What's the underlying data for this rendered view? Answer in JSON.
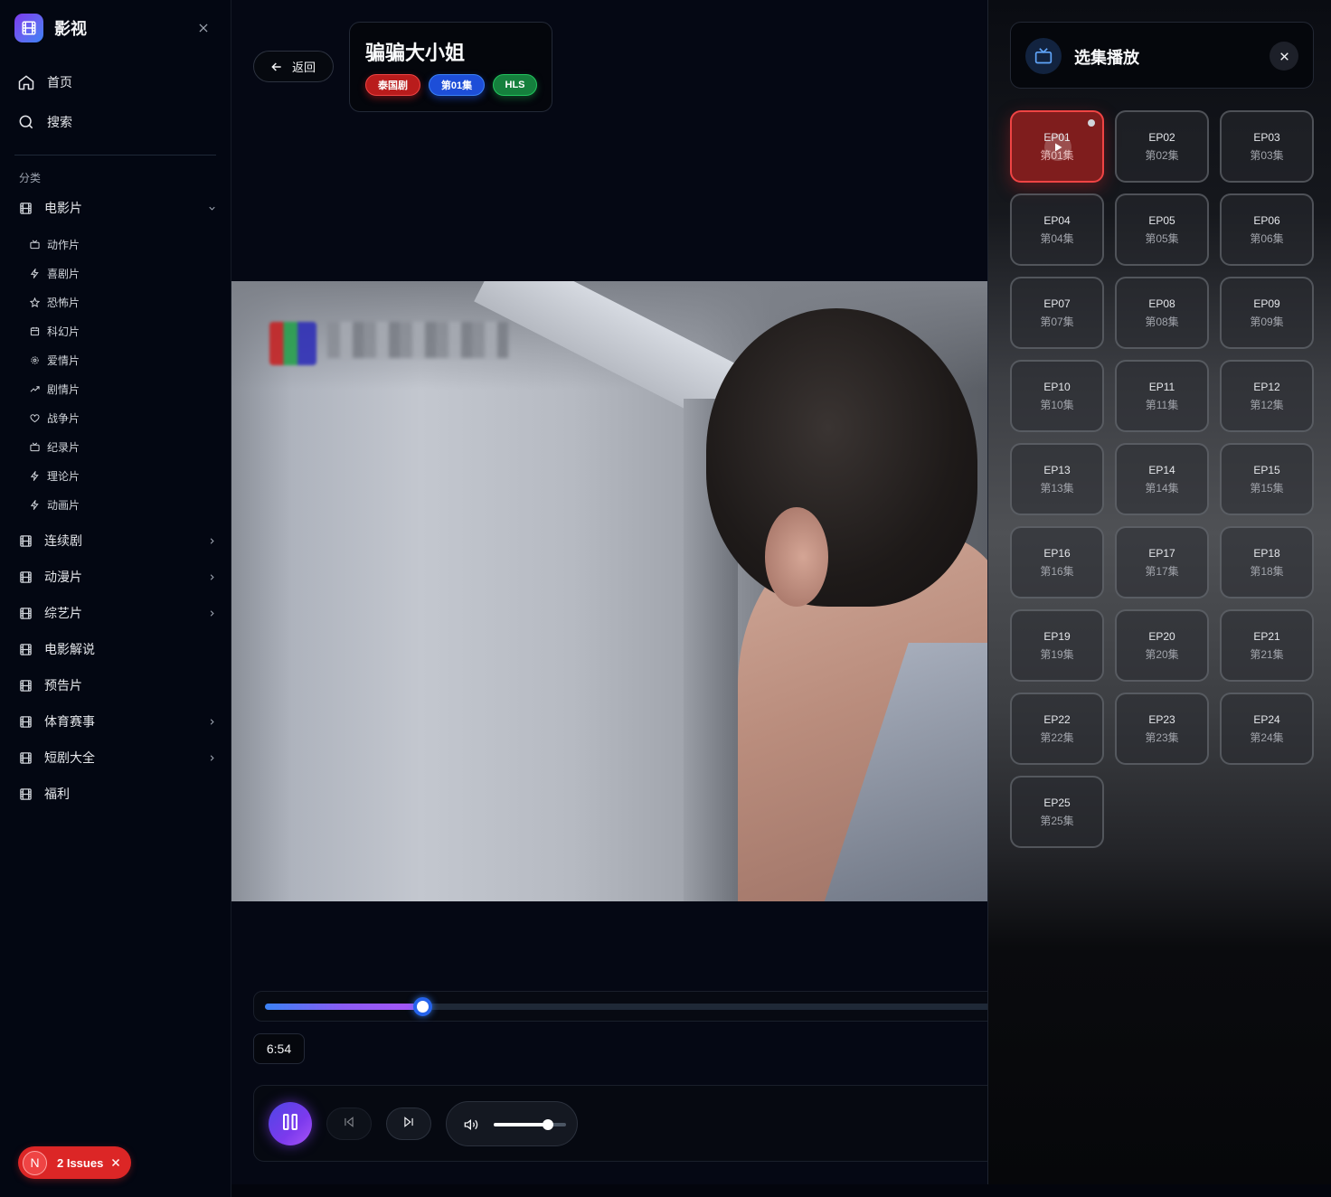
{
  "app": {
    "name": "影视"
  },
  "nav": {
    "home": "首页",
    "search": "搜索"
  },
  "sidebar": {
    "section_title": "分类",
    "movies": {
      "label": "电影片",
      "expanded": true
    },
    "sub_items": [
      {
        "label": "动作片",
        "icon": "tv-icon"
      },
      {
        "label": "喜剧片",
        "icon": "zap-icon"
      },
      {
        "label": "恐怖片",
        "icon": "star-icon"
      },
      {
        "label": "科幻片",
        "icon": "calendar-icon"
      },
      {
        "label": "爱情片",
        "icon": "settings-icon"
      },
      {
        "label": "剧情片",
        "icon": "trending-icon"
      },
      {
        "label": "战争片",
        "icon": "heart-icon"
      },
      {
        "label": "纪录片",
        "icon": "tv-icon"
      },
      {
        "label": "理论片",
        "icon": "zap-icon"
      },
      {
        "label": "动画片",
        "icon": "zap-icon"
      }
    ],
    "categories": [
      {
        "label": "连续剧",
        "has_children": true
      },
      {
        "label": "动漫片",
        "has_children": true
      },
      {
        "label": "综艺片",
        "has_children": true
      },
      {
        "label": "电影解说",
        "has_children": false
      },
      {
        "label": "预告片",
        "has_children": false
      },
      {
        "label": "体育赛事",
        "has_children": true
      },
      {
        "label": "短剧大全",
        "has_children": true
      },
      {
        "label": "福利",
        "has_children": false
      }
    ]
  },
  "issues": {
    "badge": "N",
    "label": "2 Issues"
  },
  "player": {
    "back_label": "返回",
    "title": "骗骗大小姐",
    "tags": {
      "genre": "泰国剧",
      "episode": "第01集",
      "format": "HLS"
    },
    "current_time": "6:54",
    "progress_fraction": 0.21,
    "volume_fraction": 0.75
  },
  "episode_panel": {
    "title": "选集播放",
    "active_index": 0,
    "episodes": [
      {
        "code": "EP01",
        "name": "第01集"
      },
      {
        "code": "EP02",
        "name": "第02集"
      },
      {
        "code": "EP03",
        "name": "第03集"
      },
      {
        "code": "EP04",
        "name": "第04集"
      },
      {
        "code": "EP05",
        "name": "第05集"
      },
      {
        "code": "EP06",
        "name": "第06集"
      },
      {
        "code": "EP07",
        "name": "第07集"
      },
      {
        "code": "EP08",
        "name": "第08集"
      },
      {
        "code": "EP09",
        "name": "第09集"
      },
      {
        "code": "EP10",
        "name": "第10集"
      },
      {
        "code": "EP11",
        "name": "第11集"
      },
      {
        "code": "EP12",
        "name": "第12集"
      },
      {
        "code": "EP13",
        "name": "第13集"
      },
      {
        "code": "EP14",
        "name": "第14集"
      },
      {
        "code": "EP15",
        "name": "第15集"
      },
      {
        "code": "EP16",
        "name": "第16集"
      },
      {
        "code": "EP17",
        "name": "第17集"
      },
      {
        "code": "EP18",
        "name": "第18集"
      },
      {
        "code": "EP19",
        "name": "第19集"
      },
      {
        "code": "EP20",
        "name": "第20集"
      },
      {
        "code": "EP21",
        "name": "第21集"
      },
      {
        "code": "EP22",
        "name": "第22集"
      },
      {
        "code": "EP23",
        "name": "第23集"
      },
      {
        "code": "EP24",
        "name": "第24集"
      },
      {
        "code": "EP25",
        "name": "第25集"
      }
    ]
  },
  "colors": {
    "accent": "#7c3aed",
    "active_episode": "#b91c1c",
    "progress_start": "#3b82f6",
    "progress_end": "#a855f7"
  }
}
